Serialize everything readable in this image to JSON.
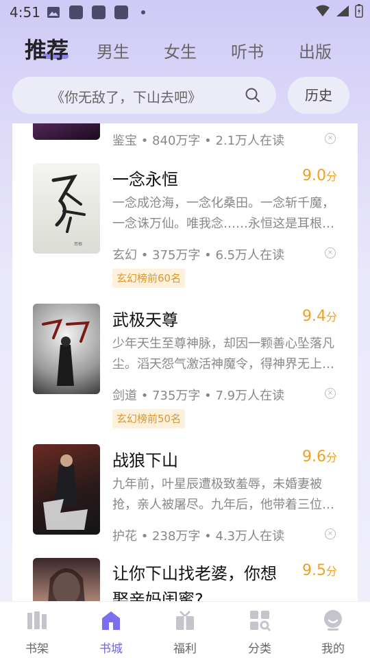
{
  "status_bar": {
    "time": "4:51"
  },
  "tabs": [
    {
      "label": "推荐",
      "active": true
    },
    {
      "label": "男生"
    },
    {
      "label": "女生"
    },
    {
      "label": "听书"
    },
    {
      "label": "出版"
    }
  ],
  "search": {
    "placeholder": "《你无敌了，下山去吧》",
    "history_label": "历史"
  },
  "books": [
    {
      "title": "",
      "meta": "鉴宝 • 840万字 • 2.1万人在读"
    },
    {
      "title": "一念永恒",
      "score": "9.0",
      "score_unit": "分",
      "desc_line1": "一念成沧海，一念化桑田。一念斩千魔，",
      "desc_line2": "一念诛万仙。唯我念……永恒这是耳根继…",
      "meta": "玄幻 • 375万字 • 6.5万人在读",
      "tag": "玄幻榜前60名"
    },
    {
      "title": "武极天尊",
      "score": "9.4",
      "score_unit": "分",
      "desc_line1": "少年天生至尊神脉，却因一颗善心坠落凡",
      "desc_line2": "尘。滔天怨气激活神魔令，得神界无上…",
      "meta": "剑道 • 735万字 • 7.9万人在读",
      "tag": "玄幻榜前50名"
    },
    {
      "title": "战狼下山",
      "score": "9.6",
      "score_unit": "分",
      "desc_line1": "九年前，叶星辰遭极致羞辱，未婚妻被",
      "desc_line2": "抢，亲人被屠尽。九年后，他带着三位…",
      "meta": "护花 • 238万字 • 4.3万人在读"
    },
    {
      "title_line1": "让你下山找老婆，你想",
      "title_line2": "娶亲妈闺蜜?",
      "score": "9.5",
      "score_unit": "分"
    }
  ],
  "bottom_nav": [
    {
      "label": "书架"
    },
    {
      "label": "书城",
      "active": true
    },
    {
      "label": "福利"
    },
    {
      "label": "分类"
    },
    {
      "label": "我的"
    }
  ],
  "colors": {
    "accent": "#6f63e8",
    "score": "#f0a01e",
    "tag_bg": "#fdf1dc"
  }
}
